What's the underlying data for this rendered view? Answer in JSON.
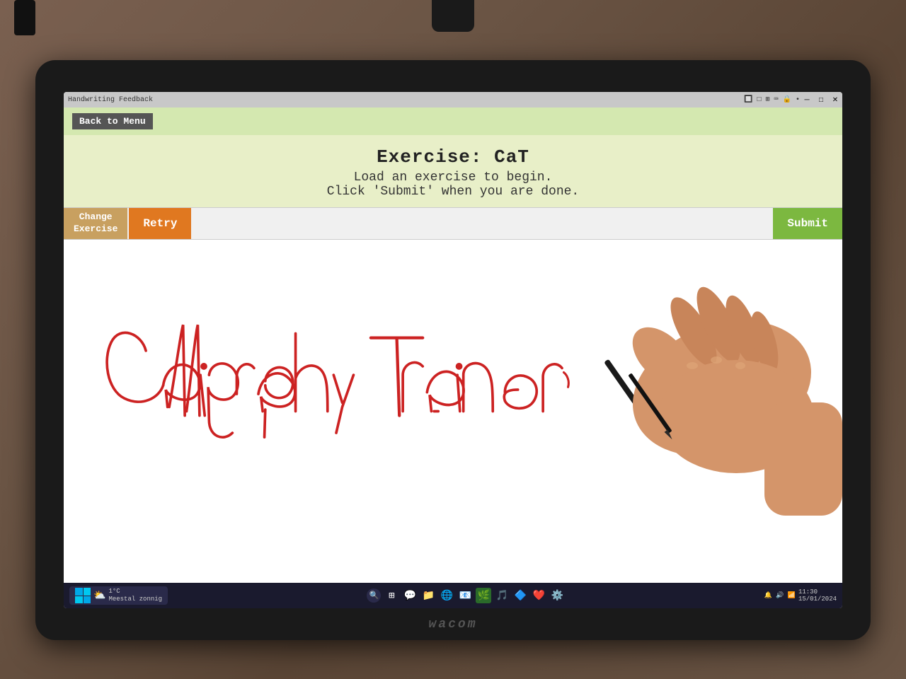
{
  "window": {
    "title": "Handwriting Feedback",
    "close_label": "✕",
    "minimize_label": "─",
    "maximize_label": "□"
  },
  "toolbar": {
    "back_label": "Back to Menu",
    "change_exercise_label": "Change\nExercise",
    "retry_label": "Retry",
    "submit_label": "Submit"
  },
  "header": {
    "title": "Exercise: CaT",
    "subtitle": "Load an exercise to begin.",
    "instruction": "Click 'Submit' when you are done."
  },
  "taskbar": {
    "weather_icon": "⛅",
    "weather_line1": "1°C",
    "weather_line2": "Meestal zonnig"
  },
  "wacom": {
    "label": "wacom"
  }
}
